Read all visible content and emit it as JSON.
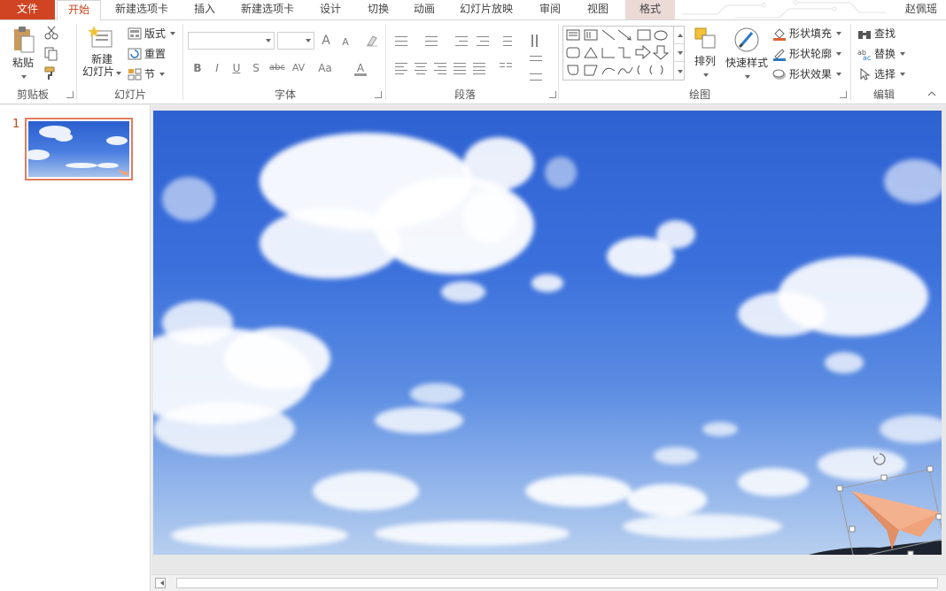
{
  "app": {
    "user": "赵佩瑶"
  },
  "tabs": [
    {
      "label": "文件",
      "id": "file"
    },
    {
      "label": "开始",
      "id": "home"
    },
    {
      "label": "新建选项卡",
      "id": "newtab1"
    },
    {
      "label": "插入",
      "id": "insert"
    },
    {
      "label": "新建选项卡",
      "id": "newtab2"
    },
    {
      "label": "设计",
      "id": "design"
    },
    {
      "label": "切换",
      "id": "transitions"
    },
    {
      "label": "动画",
      "id": "animations"
    },
    {
      "label": "幻灯片放映",
      "id": "slideshow"
    },
    {
      "label": "审阅",
      "id": "review"
    },
    {
      "label": "视图",
      "id": "view"
    },
    {
      "label": "格式",
      "id": "format"
    }
  ],
  "ribbon": {
    "clipboard": {
      "label": "剪贴板",
      "paste": "粘贴"
    },
    "slides": {
      "label": "幻灯片",
      "new_slide_line1": "新建",
      "new_slide_line2": "幻灯片",
      "layout": "版式",
      "reset": "重置",
      "section": "节"
    },
    "font": {
      "label": "字体",
      "bold": "B",
      "italic": "I",
      "underline": "U",
      "shadow": "S",
      "strike": "abc",
      "spacing": "AV",
      "case": "Aa",
      "color": "A",
      "grow": "A",
      "shrink": "A"
    },
    "paragraph": {
      "label": "段落"
    },
    "drawing": {
      "label": "绘图",
      "arrange": "排列",
      "quick_styles": "快速样式",
      "shape_fill": "形状填充",
      "shape_outline": "形状轮廓",
      "shape_effects": "形状效果"
    },
    "editing": {
      "label": "编辑",
      "find": "查找",
      "replace": "替换",
      "select": "选择"
    }
  },
  "slides_panel": {
    "slides": [
      {
        "number": "1"
      }
    ]
  },
  "colors": {
    "accent": "#d04423",
    "sky_top": "#2e62d2",
    "plane": "#f0a27a"
  }
}
